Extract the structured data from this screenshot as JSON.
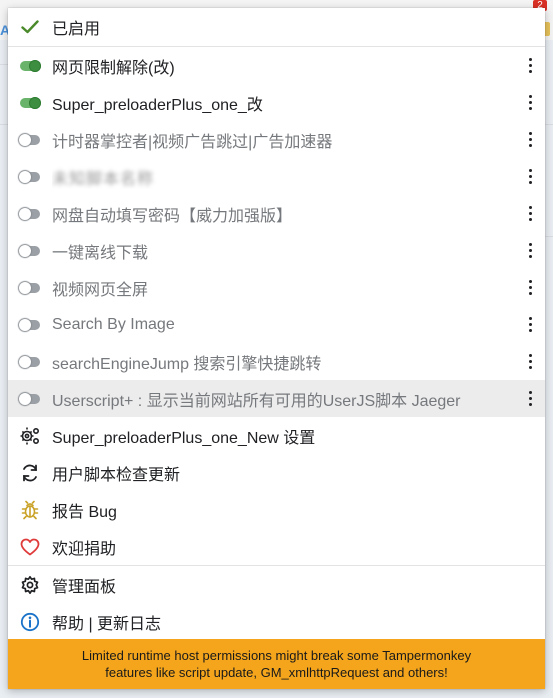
{
  "background": {
    "badge": "2",
    "left_fragment": "AK"
  },
  "menu": {
    "header_label": "已启用",
    "scripts": [
      {
        "name": "网页限制解除(改)",
        "enabled": true
      },
      {
        "name": "Super_preloaderPlus_one_改",
        "enabled": true
      },
      {
        "name": "计时器掌控者|视频广告跳过|广告加速器",
        "enabled": false
      },
      {
        "name": "未知脚本名称",
        "enabled": false,
        "obscured": true
      },
      {
        "name": "网盘自动填写密码【威力加强版】",
        "enabled": false
      },
      {
        "name": "一键离线下载",
        "enabled": false
      },
      {
        "name": "视频网页全屏",
        "enabled": false
      },
      {
        "name": "Search By Image",
        "enabled": false
      },
      {
        "name": "searchEngineJump 搜索引擎快捷跳转",
        "enabled": false
      },
      {
        "name": "Userscript+ : 显示当前网站所有可用的UserJS脚本 Jaeger",
        "enabled": false,
        "hovered": true
      }
    ],
    "actions": [
      {
        "label": "Super_preloaderPlus_one_New 设置",
        "icon": "gears-icon"
      },
      {
        "label": "用户脚本检查更新",
        "icon": "refresh-icon"
      },
      {
        "label": "报告 Bug",
        "icon": "bug-icon"
      },
      {
        "label": "欢迎捐助",
        "icon": "heart-icon"
      }
    ],
    "bottom": [
      {
        "label": "管理面板",
        "icon": "gear-icon"
      },
      {
        "label": "帮助 | 更新日志",
        "icon": "info-icon"
      }
    ],
    "warning": {
      "line1": "Limited runtime host permissions might break some Tampermonkey",
      "line2": "features like script update, GM_xmlhttpRequest and others!"
    }
  },
  "colors": {
    "toggle_on": "#3e8e41",
    "warning_bg": "#f4a51c",
    "check": "#4a8a2a",
    "heart": "#e03b3b",
    "bug": "#c9a227",
    "info": "#1a73c8"
  }
}
